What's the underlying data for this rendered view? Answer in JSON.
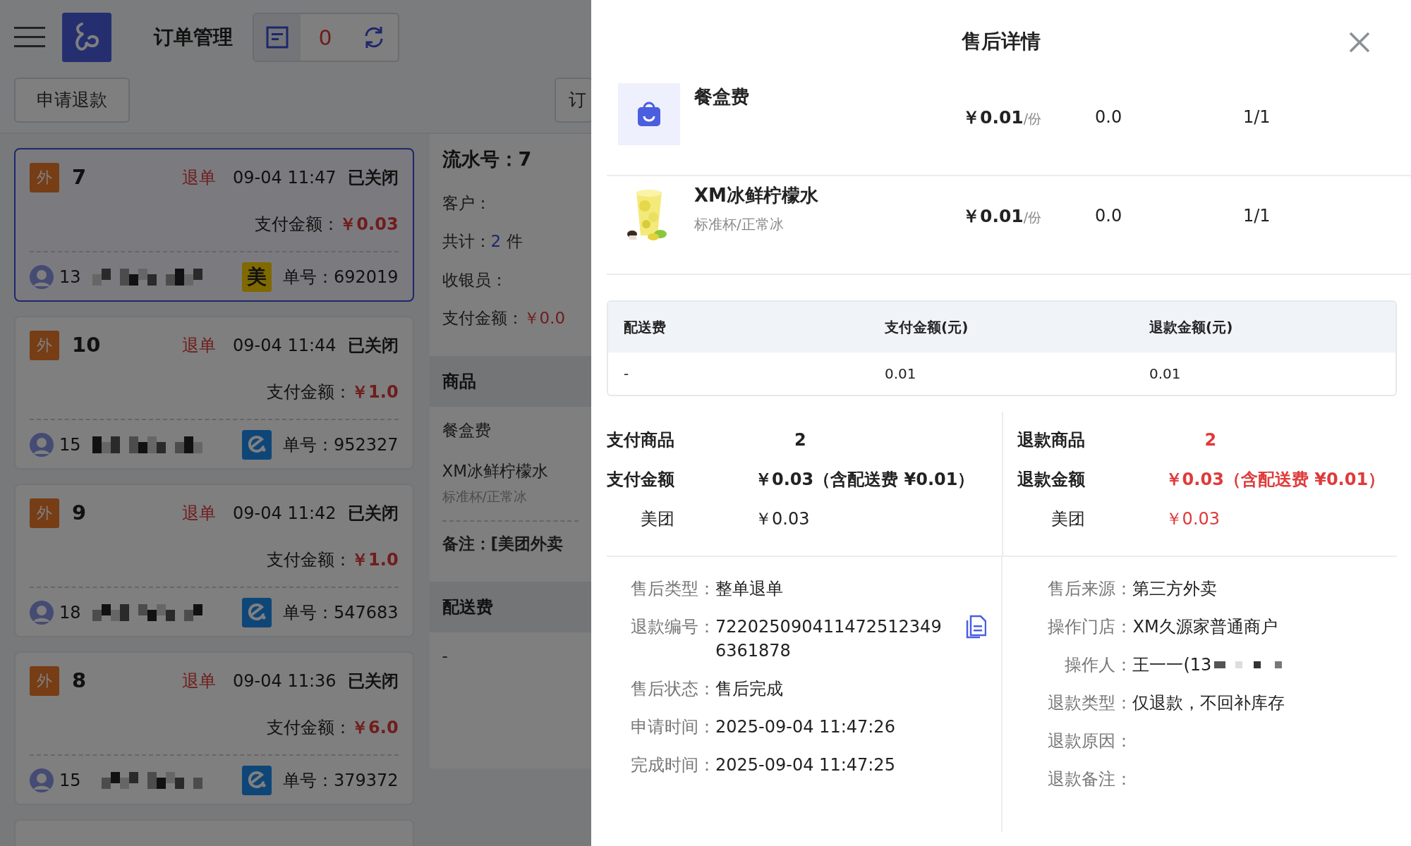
{
  "app_bar": {
    "title": "订单管理",
    "pending_count": "0"
  },
  "toolbar": {
    "refund_button": "申请退款",
    "cut_button": "订"
  },
  "orders": [
    {
      "channel": "外",
      "serial": "7",
      "refund_tag": "退单",
      "time": "09-04 11:47",
      "status": "已关闭",
      "pay_label": "支付金额：",
      "pay_amount": "￥0.03",
      "phone": "13",
      "platform": {
        "kind": "meituan",
        "text": "美"
      },
      "order_no_label": "单号：",
      "order_no": "692019",
      "selected": true
    },
    {
      "channel": "外",
      "serial": "10",
      "refund_tag": "退单",
      "time": "09-04 11:44",
      "status": "已关闭",
      "pay_label": "支付金额：",
      "pay_amount": "￥1.0",
      "phone": "15",
      "platform": {
        "kind": "eleme"
      },
      "order_no_label": "单号：",
      "order_no": "952327",
      "selected": false
    },
    {
      "channel": "外",
      "serial": "9",
      "refund_tag": "退单",
      "time": "09-04 11:42",
      "status": "已关闭",
      "pay_label": "支付金额：",
      "pay_amount": "￥1.0",
      "phone": "18",
      "platform": {
        "kind": "eleme"
      },
      "order_no_label": "单号：",
      "order_no": "547683",
      "selected": false
    },
    {
      "channel": "外",
      "serial": "8",
      "refund_tag": "退单",
      "time": "09-04 11:36",
      "status": "已关闭",
      "pay_label": "支付金额：",
      "pay_amount": "￥6.0",
      "phone": "15",
      "platform": {
        "kind": "eleme"
      },
      "order_no_label": "单号：",
      "order_no": "379372",
      "selected": false
    }
  ],
  "order_detail": {
    "serial_label": "流水号：",
    "serial": "7",
    "customer_label": "客户：",
    "total_label": "共计：",
    "total_count": "2",
    "total_unit": "件",
    "cashier_label": "收银员：",
    "pay_label": "支付金额：",
    "pay_amount": "￥0.0",
    "goods_header": "商品",
    "goods": [
      {
        "name": "餐盒费"
      },
      {
        "name": "XM冰鲜柠檬水",
        "spec": "标准杯/正常冰"
      }
    ],
    "remark": "备注：[美团外卖",
    "delivery_header": "配送费",
    "delivery_value": "-"
  },
  "after_sale": {
    "title": "售后详情",
    "items": [
      {
        "kind": "bag",
        "name": "餐盒费",
        "price": "￥0.01",
        "unit": "/份",
        "column_3": "0.0",
        "column_4": "1/1"
      },
      {
        "kind": "picture",
        "name": "XM冰鲜柠檬水",
        "spec": "标准杯/正常冰",
        "price": "￥0.01",
        "unit": "/份",
        "column_3": "0.0",
        "column_4": "1/1"
      }
    ],
    "delivery_table": {
      "columns": [
        "配送费",
        "支付金额(元)",
        "退款金额(元)"
      ],
      "rows": [
        [
          "-",
          "0.01",
          "0.01"
        ]
      ]
    },
    "summary": [
      {
        "kind": "paid",
        "goods_label": "支付商品",
        "goods_count": "2",
        "amount_label": "支付金额",
        "amount": "￥0.03（含配送费 ¥0.01）",
        "channel_label": "美团",
        "channel_amount": "￥0.03"
      },
      {
        "kind": "refund",
        "goods_label": "退款商品",
        "goods_count": "2",
        "amount_label": "退款金额",
        "amount": "￥0.03（含配送费 ¥0.01）",
        "channel_label": "美团",
        "channel_amount": "￥0.03"
      }
    ],
    "info_left": [
      {
        "label": "售后类型：",
        "value": "整单退单"
      },
      {
        "label": "退款编号：",
        "value": "7220250904114725123496361878",
        "copyable": true
      },
      {
        "label": "售后状态：",
        "value": "售后完成"
      },
      {
        "label": "申请时间：",
        "value": "2025-09-04 11:47:26"
      },
      {
        "label": "完成时间：",
        "value": "2025-09-04 11:47:25"
      }
    ],
    "info_right": [
      {
        "label": "售后来源：",
        "value": "第三方外卖"
      },
      {
        "label": "操作门店：",
        "value": "XM久源家普通商户"
      },
      {
        "label": "操作人：",
        "value": "王一一(13",
        "masked": true
      },
      {
        "label": "退款类型：",
        "value": "仅退款，不回补库存"
      },
      {
        "label": "退款原因："
      },
      {
        "label": "退款备注："
      }
    ]
  }
}
